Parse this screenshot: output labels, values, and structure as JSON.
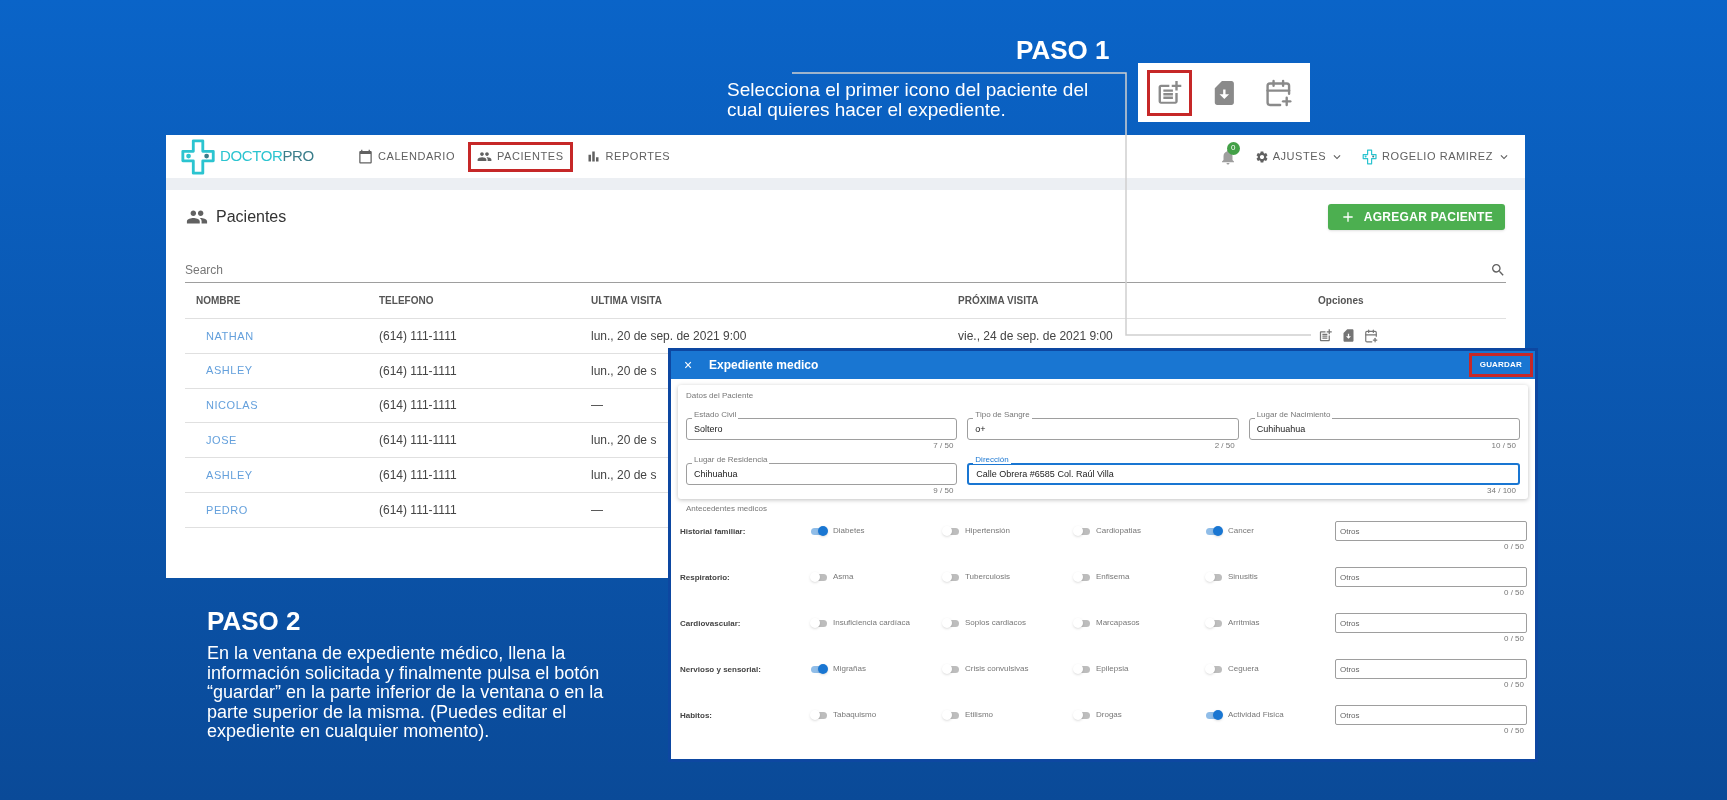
{
  "step1": {
    "title": "PASO 1",
    "text": "Selecciona el primer icono del paciente del cual quieres hacer el expediente.",
    "icons": [
      {
        "kind": "add-record",
        "highlighted": true
      },
      {
        "kind": "download",
        "highlighted": false
      },
      {
        "kind": "calendar",
        "highlighted": false
      }
    ]
  },
  "step2": {
    "title": "PASO 2",
    "text": "En la ventana de expediente médico, llena la información solicitada y finalmente pulsa el botón “guardar” en la parte inferior de la ventana o en la parte superior de la misma. (Puedes editar el expediente en cualquier momento)."
  },
  "app": {
    "logo": {
      "part_a": "DOCTOR",
      "part_b": "PRO"
    },
    "nav": [
      {
        "kind": "calendar",
        "label": "CALENDARIO",
        "highlighted": false
      },
      {
        "kind": "patients",
        "label": "PACIENTES",
        "highlighted": true
      },
      {
        "kind": "reports",
        "label": "REPORTES",
        "highlighted": false
      }
    ],
    "notifications": "0",
    "settings": "AJUSTES",
    "user": "ROGELIO RAMIREZ",
    "page_title": "Pacientes",
    "add_button": "AGREGAR PACIENTE",
    "search": {
      "placeholder": "Search"
    },
    "table": {
      "columns": [
        "NOMBRE",
        "TELEFONO",
        "ULTIMA VISITA",
        "PRÓXIMA VISITA",
        "Opciones"
      ],
      "rows": [
        {
          "nombre": "NATHAN",
          "telefono": "(614) 111-1111",
          "ultima": "lun., 20 de sep. de 2021 9:00",
          "proxima": "vie., 24 de sep. de 2021 9:00"
        },
        {
          "nombre": "ASHLEY",
          "telefono": "(614) 111-1111",
          "ultima": "lun., 20 de s"
        },
        {
          "nombre": "NICOLAS",
          "telefono": "(614) 111-1111",
          "ultima": "—"
        },
        {
          "nombre": "JOSE",
          "telefono": "(614) 111-1111",
          "ultima": "lun., 20 de s"
        },
        {
          "nombre": "ASHLEY",
          "telefono": "(614) 111-1111",
          "ultima": "lun., 20 de s"
        },
        {
          "nombre": "PEDRO",
          "telefono": "(614) 111-1111",
          "ultima": "—"
        }
      ]
    }
  },
  "dialog": {
    "close": "×",
    "title": "Expediente medico",
    "save": {
      "label": "GUARDAR",
      "highlighted": true
    },
    "patient_section": "Datos del Paciente",
    "fields": [
      {
        "label": "Estado Civil",
        "value": "Soltero",
        "counter": "7 / 50",
        "wide": false,
        "focused": false
      },
      {
        "label": "Tipo de Sangre",
        "value": "o+",
        "counter": "2 / 50",
        "wide": false,
        "focused": false
      },
      {
        "label": "Lugar de Nacimiento",
        "value": "Cuhihuahua",
        "counter": "10 / 50",
        "wide": false,
        "focused": false
      },
      {
        "label": "Lugar de Residencia",
        "value": "Chihuahua",
        "counter": "9 / 50",
        "wide": false,
        "focused": false
      },
      {
        "label": "Dirección",
        "value": "Calle Obrera #6585 Col. Raúl Villa",
        "counter": "34 / 100",
        "wide": true,
        "focused": true
      }
    ],
    "history_section": "Antecedentes medicos",
    "groups": [
      {
        "label": "Historial familiar:",
        "items": [
          {
            "label": "Diabetes",
            "on": true
          },
          {
            "label": "Hipertensión",
            "on": false
          },
          {
            "label": "Cardiopatias",
            "on": false
          },
          {
            "label": "Cancer",
            "on": true
          }
        ],
        "other": {
          "placeholder": "Otros",
          "counter": "0 / 50"
        }
      },
      {
        "label": "Respiratorio:",
        "items": [
          {
            "label": "Asma",
            "on": false
          },
          {
            "label": "Tuberculosis",
            "on": false
          },
          {
            "label": "Enfisema",
            "on": false
          },
          {
            "label": "Sinusitis",
            "on": false
          }
        ],
        "other": {
          "placeholder": "Otros",
          "counter": "0 / 50"
        }
      },
      {
        "label": "Cardiovascular:",
        "items": [
          {
            "label": "Insuficiencia cardíaca",
            "on": false
          },
          {
            "label": "Soplos cardiacos",
            "on": false
          },
          {
            "label": "Marcapasos",
            "on": false
          },
          {
            "label": "Arritmias",
            "on": false
          }
        ],
        "other": {
          "placeholder": "Otros",
          "counter": "0 / 50"
        }
      },
      {
        "label": "Nervioso y sensorial:",
        "items": [
          {
            "label": "Migrañas",
            "on": true
          },
          {
            "label": "Crisis convulsivas",
            "on": false
          },
          {
            "label": "Epilepsia",
            "on": false
          },
          {
            "label": "Ceguera",
            "on": false
          }
        ],
        "other": {
          "placeholder": "Otros",
          "counter": "0 / 50"
        }
      },
      {
        "label": "Habitos:",
        "items": [
          {
            "label": "Tabaquismo",
            "on": false
          },
          {
            "label": "Etilismo",
            "on": false
          },
          {
            "label": "Drogas",
            "on": false
          },
          {
            "label": "Actividad Fisica",
            "on": true
          }
        ],
        "other": {
          "placeholder": "Otros",
          "counter": "0 / 50"
        }
      }
    ]
  }
}
